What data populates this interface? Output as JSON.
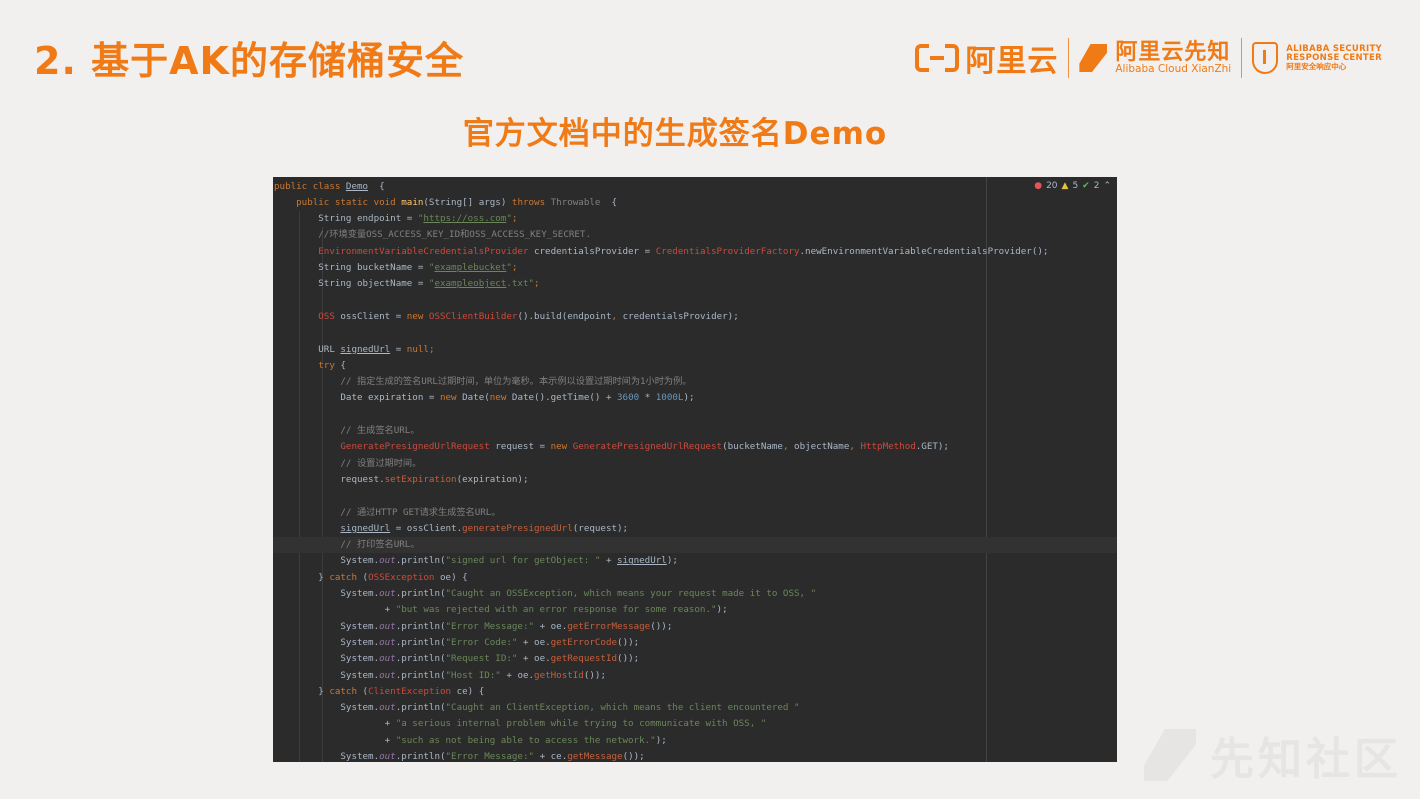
{
  "slide": {
    "title": "2. 基于AK的存储桶安全",
    "subtitle": "官方文档中的生成签名Demo"
  },
  "logos": {
    "aliyun": "阿里云",
    "xianzhi_cn": "阿里云先知",
    "xianzhi_en": "Alibaba Cloud XianZhi",
    "asrc_line1": "ALIBABA SECURITY",
    "asrc_line2": "RESPONSE CENTER",
    "asrc_line3": "阿里安全响应中心"
  },
  "colors": {
    "accent": "#f07a16",
    "editor_bg": "#2b2b2b",
    "keyword": "#cc7832",
    "string": "#6a8759",
    "comment": "#808080",
    "number": "#6897bb"
  },
  "editor": {
    "inspections": {
      "errors": "20",
      "warnings": "5",
      "ok": "2",
      "icons": [
        "error-icon",
        "warning-icon",
        "check-icon",
        "chevron-up-icon"
      ]
    },
    "lines": [
      [
        [
          "kw",
          "public class "
        ],
        [
          "und",
          "Demo"
        ],
        [
          "",
          "  {"
        ]
      ],
      [
        [
          "",
          "    "
        ],
        [
          "kw",
          "public static void "
        ],
        [
          "mtd",
          "main"
        ],
        [
          "",
          "(String[] args) "
        ],
        [
          "kw",
          "throws "
        ],
        [
          "cmt",
          "Throwable"
        ],
        [
          "",
          "  {"
        ]
      ],
      [
        [
          "",
          "        String endpoint = "
        ],
        [
          "str",
          "\""
        ],
        [
          "str und",
          "https://oss.com"
        ],
        [
          "str",
          "\""
        ],
        [
          "kw",
          ";"
        ]
      ],
      [
        [
          "cmt",
          "        //环境变量OSS_ACCESS_KEY_ID和OSS_ACCESS_KEY_SECRET."
        ]
      ],
      [
        [
          "cls",
          "        EnvironmentVariableCredentialsProvider"
        ],
        [
          "",
          " credentialsProvider = "
        ],
        [
          "cls",
          "CredentialsProviderFactory"
        ],
        [
          "",
          ".newEnvironmentVariableCredentialsProvider();"
        ]
      ],
      [
        [
          "",
          "        String bucketName = "
        ],
        [
          "str",
          "\""
        ],
        [
          "str und",
          "examplebucket"
        ],
        [
          "str",
          "\""
        ],
        [
          "kw",
          ";"
        ]
      ],
      [
        [
          "",
          "        String objectName = "
        ],
        [
          "str",
          "\""
        ],
        [
          "str und",
          "exampleobject"
        ],
        [
          "str",
          ".txt\""
        ],
        [
          "kw",
          ";"
        ]
      ],
      [],
      [
        [
          "cls",
          "        OSS"
        ],
        [
          "",
          " ossClient = "
        ],
        [
          "kw",
          "new "
        ],
        [
          "cls",
          "OSSClientBuilder"
        ],
        [
          "",
          "().build(endpoint"
        ],
        [
          "kw",
          ", "
        ],
        [
          "",
          "credentialsProvider);"
        ]
      ],
      [],
      [
        [
          "",
          "        URL "
        ],
        [
          "und",
          "signedUrl"
        ],
        [
          "",
          " = "
        ],
        [
          "kw",
          "null"
        ],
        [
          "kw",
          ";"
        ]
      ],
      [
        [
          "kw",
          "        try "
        ],
        [
          "",
          "{"
        ]
      ],
      [
        [
          "cmt",
          "            // 指定生成的签名URL过期时间，单位为毫秒。本示例以设置过期时间为1小时为例。"
        ]
      ],
      [
        [
          "",
          "            Date expiration = "
        ],
        [
          "kw",
          "new "
        ],
        [
          "",
          "Date("
        ],
        [
          "kw",
          "new "
        ],
        [
          "",
          "Date().getTime() + "
        ],
        [
          "num",
          "3600"
        ],
        [
          "",
          " * "
        ],
        [
          "num",
          "1000L"
        ],
        [
          "",
          ");"
        ]
      ],
      [],
      [
        [
          "cmt",
          "            // 生成签名URL。"
        ]
      ],
      [
        [
          "cls",
          "            GeneratePresignedUrlRequest"
        ],
        [
          "",
          " request = "
        ],
        [
          "kw",
          "new "
        ],
        [
          "cls",
          "GeneratePresignedUrlRequest"
        ],
        [
          "",
          "(bucketName"
        ],
        [
          "kw",
          ", "
        ],
        [
          "",
          "objectName"
        ],
        [
          "kw",
          ", "
        ],
        [
          "cls",
          "HttpMethod"
        ],
        [
          "",
          ".GET);"
        ]
      ],
      [
        [
          "cmt",
          "            // 设置过期时间。"
        ]
      ],
      [
        [
          "",
          "            request."
        ],
        [
          "call",
          "setExpiration"
        ],
        [
          "",
          "(expiration);"
        ]
      ],
      [],
      [
        [
          "cmt",
          "            // 通过HTTP GET请求生成签名URL。"
        ]
      ],
      [
        [
          "",
          "            "
        ],
        [
          "und",
          "signedUrl"
        ],
        [
          "",
          " = ossClient."
        ],
        [
          "call",
          "generatePresignedUrl"
        ],
        [
          "",
          "(request);"
        ]
      ],
      [
        [
          "cmt",
          "            // 打印签名URL。"
        ]
      ],
      [
        [
          "",
          "            System."
        ],
        [
          "stat",
          "out"
        ],
        [
          "",
          ".println("
        ],
        [
          "str",
          "\"signed url for getObject: \""
        ],
        [
          "",
          " + "
        ],
        [
          "und",
          "signedUrl"
        ],
        [
          "",
          ");"
        ]
      ],
      [
        [
          "",
          "        } "
        ],
        [
          "kw",
          "catch "
        ],
        [
          "",
          "("
        ],
        [
          "cls",
          "OSSException"
        ],
        [
          "",
          " oe) {"
        ]
      ],
      [
        [
          "",
          "            System."
        ],
        [
          "stat",
          "out"
        ],
        [
          "",
          ".println("
        ],
        [
          "str",
          "\"Caught an OSSException, which means your request made it to OSS, \""
        ]
      ],
      [
        [
          "",
          "                    + "
        ],
        [
          "str",
          "\"but was rejected with an error response for some reason.\""
        ],
        [
          "",
          ");"
        ]
      ],
      [
        [
          "",
          "            System."
        ],
        [
          "stat",
          "out"
        ],
        [
          "",
          ".println("
        ],
        [
          "str",
          "\"Error Message:\""
        ],
        [
          "",
          " + oe."
        ],
        [
          "call",
          "getErrorMessage"
        ],
        [
          "",
          "());"
        ]
      ],
      [
        [
          "",
          "            System."
        ],
        [
          "stat",
          "out"
        ],
        [
          "",
          ".println("
        ],
        [
          "str",
          "\"Error Code:\""
        ],
        [
          "",
          " + oe."
        ],
        [
          "call",
          "getErrorCode"
        ],
        [
          "",
          "());"
        ]
      ],
      [
        [
          "",
          "            System."
        ],
        [
          "stat",
          "out"
        ],
        [
          "",
          ".println("
        ],
        [
          "str",
          "\"Request ID:\""
        ],
        [
          "",
          " + oe."
        ],
        [
          "call",
          "getRequestId"
        ],
        [
          "",
          "());"
        ]
      ],
      [
        [
          "",
          "            System."
        ],
        [
          "stat",
          "out"
        ],
        [
          "",
          ".println("
        ],
        [
          "str",
          "\"Host ID:\""
        ],
        [
          "",
          " + oe."
        ],
        [
          "call",
          "getHostId"
        ],
        [
          "",
          "());"
        ]
      ],
      [
        [
          "",
          "        } "
        ],
        [
          "kw",
          "catch "
        ],
        [
          "",
          "("
        ],
        [
          "cls",
          "ClientException"
        ],
        [
          "",
          " ce) {"
        ]
      ],
      [
        [
          "",
          "            System."
        ],
        [
          "stat",
          "out"
        ],
        [
          "",
          ".println("
        ],
        [
          "str",
          "\"Caught an ClientException, which means the client encountered \""
        ]
      ],
      [
        [
          "",
          "                    + "
        ],
        [
          "str",
          "\"a serious internal problem while trying to communicate with OSS, \""
        ]
      ],
      [
        [
          "",
          "                    + "
        ],
        [
          "str",
          "\"such as not being able to access the network.\""
        ],
        [
          "",
          ");"
        ]
      ],
      [
        [
          "",
          "            System."
        ],
        [
          "stat",
          "out"
        ],
        [
          "",
          ".println("
        ],
        [
          "str",
          "\"Error Message:\""
        ],
        [
          "",
          " + ce."
        ],
        [
          "call",
          "getMessage"
        ],
        [
          "",
          "());"
        ]
      ]
    ]
  },
  "watermark": {
    "text": "先知社区"
  }
}
